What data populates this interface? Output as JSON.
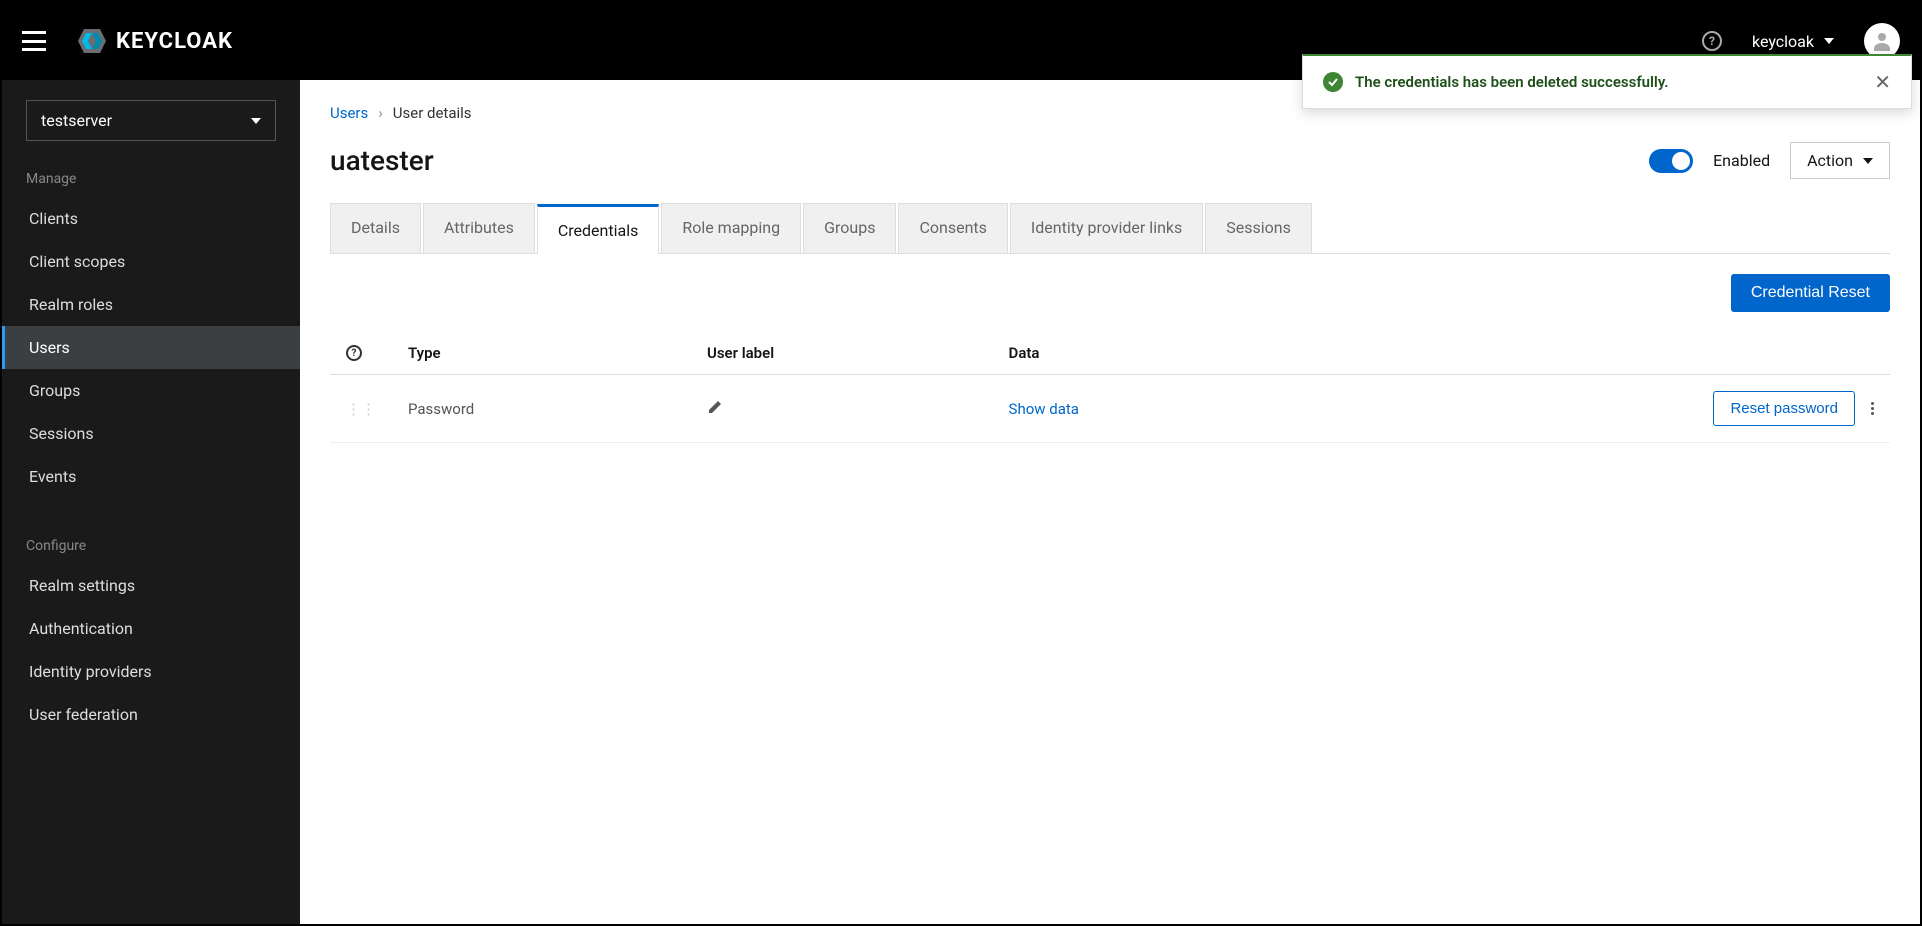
{
  "header": {
    "brand": "KEYCLOAK",
    "realm_dropdown": "keycloak"
  },
  "toast": {
    "message": "The credentials has been deleted successfully."
  },
  "sidebar": {
    "realm_selector": "testserver",
    "section_manage": "Manage",
    "section_configure": "Configure",
    "manage_items": [
      "Clients",
      "Client scopes",
      "Realm roles",
      "Users",
      "Groups",
      "Sessions",
      "Events"
    ],
    "configure_items": [
      "Realm settings",
      "Authentication",
      "Identity providers",
      "User federation"
    ],
    "active_item": "Users"
  },
  "breadcrumb": {
    "root": "Users",
    "current": "User details"
  },
  "page": {
    "title": "uatester",
    "enabled_label": "Enabled",
    "action_label": "Action"
  },
  "tabs": [
    "Details",
    "Attributes",
    "Credentials",
    "Role mapping",
    "Groups",
    "Consents",
    "Identity provider links",
    "Sessions"
  ],
  "active_tab": "Credentials",
  "toolbar": {
    "credential_reset": "Credential Reset"
  },
  "table": {
    "headers": {
      "type": "Type",
      "user_label": "User label",
      "data": "Data"
    },
    "row": {
      "type": "Password",
      "data_link": "Show data",
      "reset_button": "Reset password"
    }
  }
}
